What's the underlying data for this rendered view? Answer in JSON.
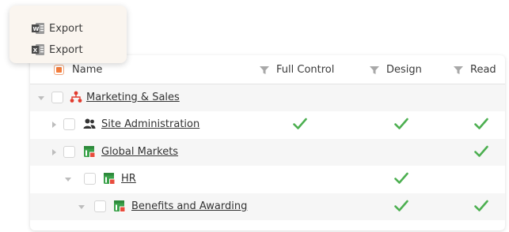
{
  "export_menu": {
    "items": [
      {
        "label": "Export",
        "icon": "word-export-icon"
      },
      {
        "label": "Export",
        "icon": "excel-export-icon"
      }
    ]
  },
  "grid": {
    "columns": {
      "name": "Name",
      "full_control": "Full Control",
      "design": "Design",
      "read": "Read"
    },
    "rows": [
      {
        "label": "Marketing & Sales",
        "icon": "site-collection-icon",
        "expanded": true,
        "full_control": false,
        "design": false,
        "read": false
      },
      {
        "label": "Site Administration",
        "icon": "users-group-icon",
        "expanded": false,
        "full_control": true,
        "design": true,
        "read": true
      },
      {
        "label": "Global Markets",
        "icon": "site-icon",
        "expanded": false,
        "full_control": false,
        "design": false,
        "read": true
      },
      {
        "label": "HR",
        "icon": "site-icon",
        "expanded": true,
        "full_control": false,
        "design": true,
        "read": false
      },
      {
        "label": "Benefits and Awarding",
        "icon": "site-icon",
        "expanded": true,
        "full_control": false,
        "design": true,
        "read": true
      }
    ]
  },
  "colors": {
    "check": "#4caf50",
    "accent": "#f47d3c",
    "site_icon": "#3aa24a",
    "site_badge": "#e84c3d",
    "collection_icon": "#e23b2e"
  }
}
